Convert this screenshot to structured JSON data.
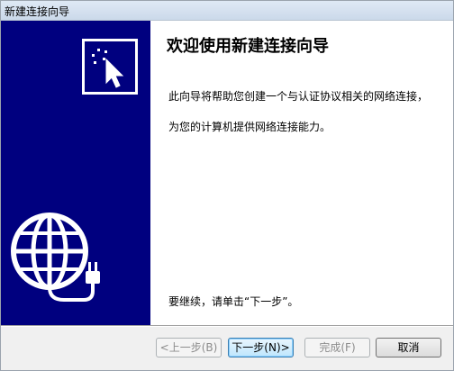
{
  "window": {
    "title": "新建连接向导"
  },
  "wizard": {
    "heading": "欢迎使用新建连接向导",
    "description_line1": "此向导将帮助您创建一个与认证协议相关的网络连接，",
    "description_line2": "为您的计算机提供网络连接能力。",
    "continue_hint": "要继续，请单击“下一步”。"
  },
  "buttons": {
    "back": "<上一步(B)",
    "next": "下一步(N)>",
    "finish": "完成(F)",
    "cancel": "取消"
  },
  "icons": {
    "cursor": "cursor-click-icon",
    "globe": "globe-network-plug-icon"
  },
  "colors": {
    "sidebar_bg": "#00007f",
    "window_bg": "#f0f0f0"
  }
}
